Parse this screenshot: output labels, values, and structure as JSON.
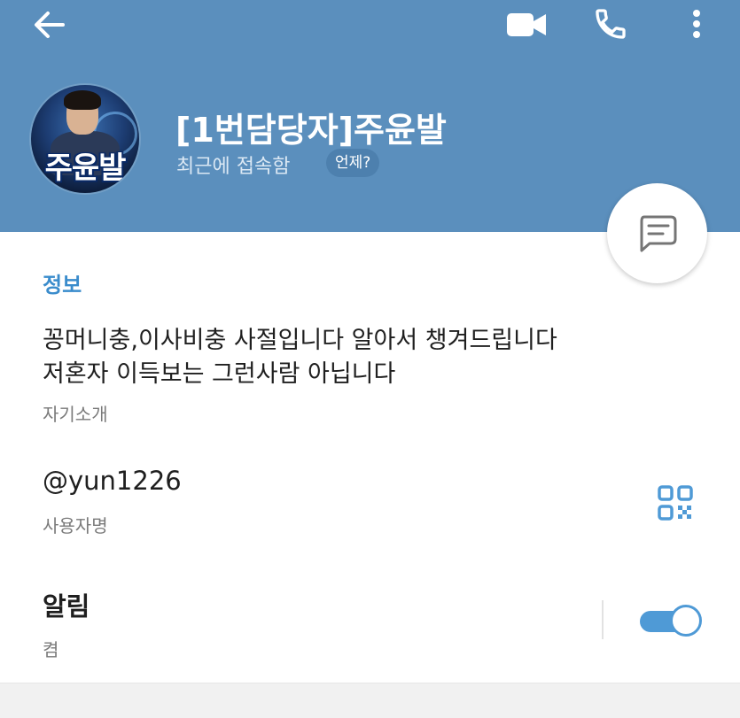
{
  "header": {
    "profile_name": "[1번담당자]주윤발",
    "last_seen": "최근에 접속함",
    "when_chip": "언제?",
    "avatar_text": "주윤발"
  },
  "info": {
    "section_title": "정보",
    "bio_line1": "꽁머니충,이사비충 사절입니다 알아서 챙겨드립니다",
    "bio_line2": "저혼자 이득보는 그런사람 아닙니다",
    "bio_caption": "자기소개",
    "username": "@yun1226",
    "username_caption": "사용자명",
    "notifications_title": "알림",
    "notifications_status": "켬",
    "notifications_enabled": true
  },
  "icons": {
    "back": "arrow-left-icon",
    "video": "video-camera-icon",
    "call": "phone-icon",
    "more": "more-vertical-icon",
    "message": "message-icon",
    "qr": "qr-code-icon"
  },
  "colors": {
    "header_bg": "#5b8fbd",
    "accent": "#3a8ccc",
    "toggle_on": "#4f9ad6"
  }
}
